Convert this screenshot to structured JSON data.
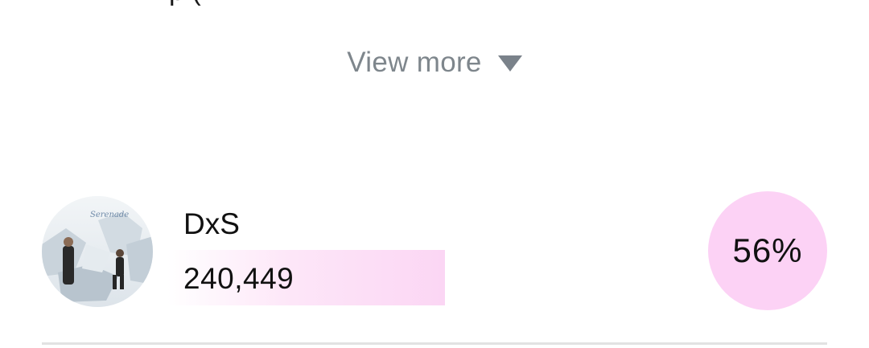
{
  "top_cutoff": {
    "text": "p  ("
  },
  "view_more": {
    "label": "View more",
    "icon": "triangle-down-icon"
  },
  "candidate": {
    "name": "DxS",
    "votes": "240,449",
    "percent": "56%",
    "percent_value": 56,
    "avatar_icon": "album-cover-avatar",
    "avatar_caption": "Serenade"
  },
  "colors": {
    "accent_pink": "#fcd2f5",
    "bar_pink": "#fbd6f4",
    "muted_gray": "#7e868c",
    "divider": "#e2e2e2"
  }
}
